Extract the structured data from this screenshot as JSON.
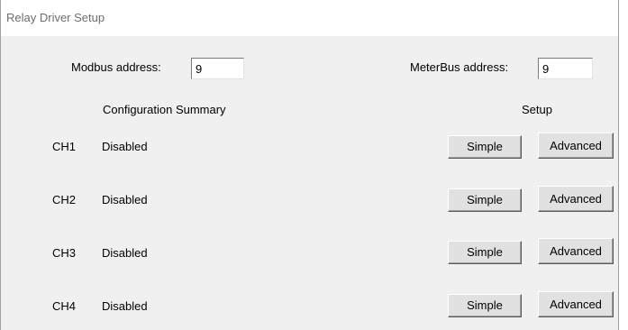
{
  "window": {
    "title": "Relay Driver Setup"
  },
  "addresses": {
    "modbus_label": "Modbus address:",
    "modbus_value": "9",
    "meterbus_label": "MeterBus address:",
    "meterbus_value": "9"
  },
  "headers": {
    "summary": "Configuration Summary",
    "setup": "Setup"
  },
  "channels": [
    {
      "name": "CH1",
      "status": "Disabled",
      "simple_label": "Simple",
      "advanced_label": "Advanced"
    },
    {
      "name": "CH2",
      "status": "Disabled",
      "simple_label": "Simple",
      "advanced_label": "Advanced"
    },
    {
      "name": "CH3",
      "status": "Disabled",
      "simple_label": "Simple",
      "advanced_label": "Advanced"
    },
    {
      "name": "CH4",
      "status": "Disabled",
      "simple_label": "Simple",
      "advanced_label": "Advanced"
    }
  ]
}
